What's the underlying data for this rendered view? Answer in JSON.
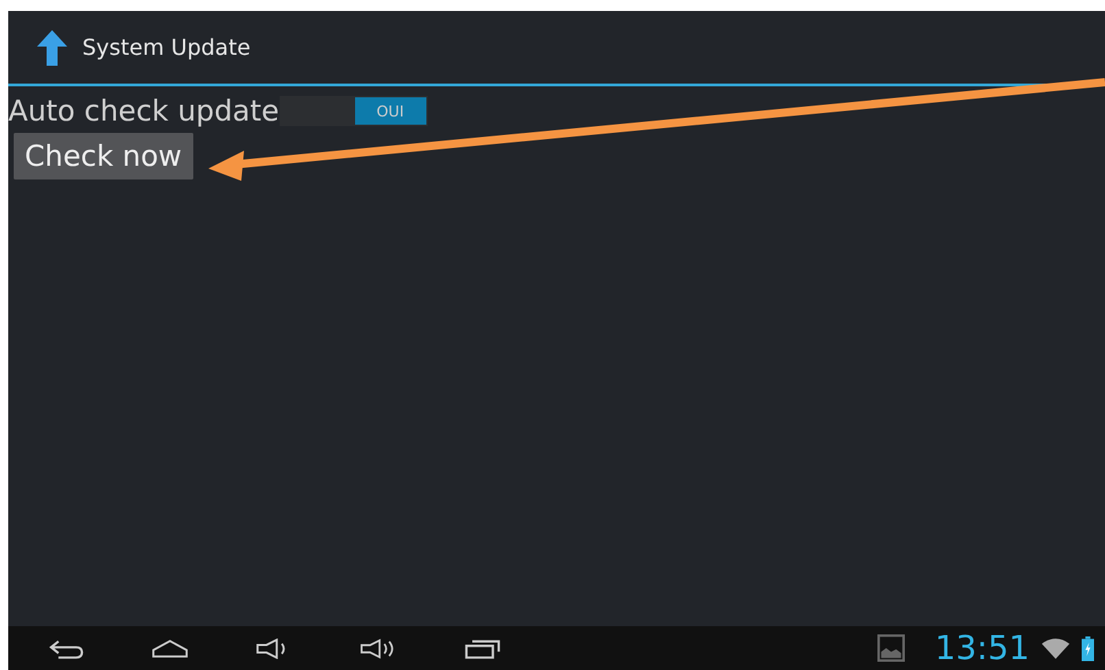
{
  "action_bar": {
    "title": "System Update"
  },
  "settings": {
    "auto_check": {
      "label": "Auto check update",
      "on": true,
      "switch_label": "OUI"
    },
    "check_button": "Check now"
  },
  "status_bar": {
    "time": "13:51"
  }
}
